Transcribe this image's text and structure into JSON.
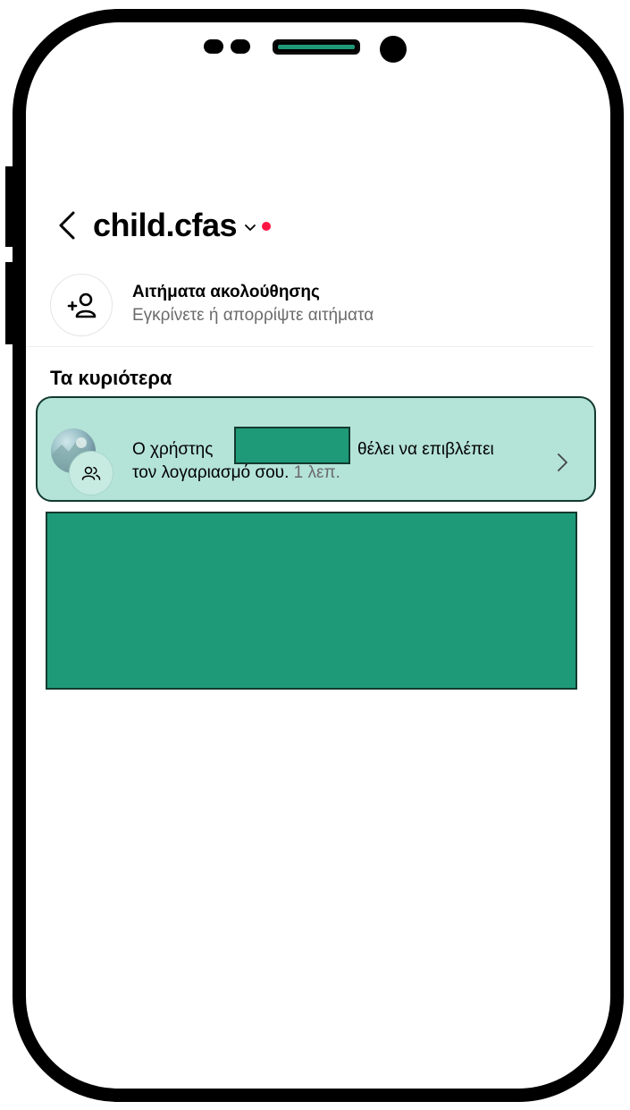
{
  "header": {
    "username": "child.cfas"
  },
  "follow_requests": {
    "title": "Αιτήματα ακολούθησης",
    "subtitle": "Εγκρίνετε ή απορρίψτε αιτήματα"
  },
  "highlights": {
    "section_title": "Τα κυριότερα",
    "notification": {
      "prefix": "Ο χρήστης",
      "suffix": "θέλει να επιβλέπει",
      "line2": "τον λογαριασμό σου.",
      "time": "1 λεπ."
    }
  },
  "icons": {
    "back": "chevron-left-icon",
    "dropdown": "chevron-down-icon",
    "add_user": "add-user-icon",
    "supervision": "people-icon",
    "open": "chevron-right-icon"
  },
  "colors": {
    "notification_dot": "#ff1744",
    "card_background": "#b4e3d7",
    "redaction": "#1f9a79"
  }
}
